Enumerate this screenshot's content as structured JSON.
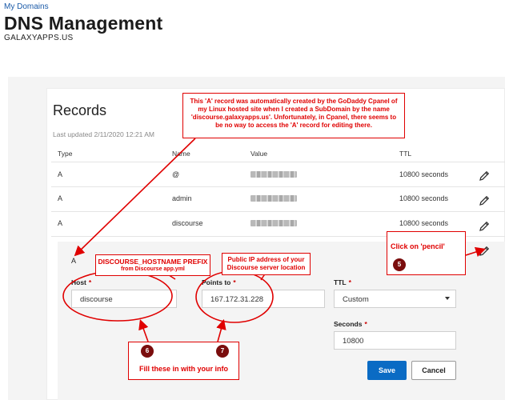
{
  "header": {
    "breadcrumb": "My Domains",
    "title": "DNS Management",
    "domain": "GALAXYAPPS.US"
  },
  "records": {
    "title": "Records",
    "last_updated": "Last updated 2/11/2020 12:21 AM",
    "columns": [
      "Type",
      "Name",
      "Value",
      "TTL"
    ],
    "rows": [
      {
        "type": "A",
        "name": "@",
        "value_redacted": true,
        "ttl": "10800 seconds"
      },
      {
        "type": "A",
        "name": "admin",
        "value_redacted": true,
        "ttl": "10800 seconds"
      },
      {
        "type": "A",
        "name": "discourse",
        "value_redacted": true,
        "ttl": "10800 seconds"
      }
    ]
  },
  "edit_form": {
    "type": "A",
    "host_label": "Host",
    "host_value": "discourse",
    "points_to_label": "Points to",
    "points_to_value": "167.172.31.228",
    "ttl_label": "TTL",
    "ttl_value": "Custom",
    "seconds_label": "Seconds",
    "seconds_value": "10800",
    "required_mark": "*",
    "save_label": "Save",
    "cancel_label": "Cancel"
  },
  "annotations": {
    "a_record_note": "This 'A' record was automatically created by the GoDaddy Cpanel of my Linux hosted site when I created a SubDomain by the name 'discourse.galaxyapps.us'.  Unfortunately, in Cpanel, there seems to be no way to access the 'A' record for editing there.",
    "hostname_prefix": "DISCOURSE_HOSTNAME PREFIX",
    "hostname_prefix_sub": "from Discourse app.yml",
    "public_ip": "Public IP address of your Discourse server location",
    "click_pencil": "Click on 'pencil'",
    "fill_info": "Fill these in with your info",
    "step_5": "5",
    "step_6": "6",
    "step_7": "7"
  },
  "colors": {
    "accent": "#0a6bc4",
    "annotation_red": "#e00000",
    "step_badge": "#7a0d0d"
  },
  "icons": [
    "pencil-icon",
    "chevron-down-icon"
  ]
}
